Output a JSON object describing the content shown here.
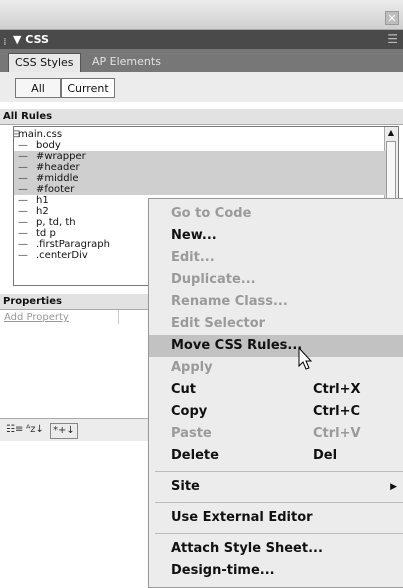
{
  "panel": {
    "title": "▼ CSS",
    "grip": "⁞",
    "menu_icon": "☰",
    "tabs": [
      {
        "label": "CSS Styles"
      },
      {
        "label": "AP Elements"
      }
    ],
    "toggles": [
      {
        "label": "All"
      },
      {
        "label": "Current"
      }
    ],
    "all_rules_heading": "All Rules",
    "rules": [
      {
        "prefix": "⊟ ",
        "label": "main.css",
        "indent": 0,
        "selected": false
      },
      {
        "prefix": "—",
        "label": "body",
        "indent": 1,
        "selected": false
      },
      {
        "prefix": "—",
        "label": "#wrapper",
        "indent": 1,
        "selected": true
      },
      {
        "prefix": "—",
        "label": "#header",
        "indent": 1,
        "selected": true
      },
      {
        "prefix": "—",
        "label": "#middle",
        "indent": 1,
        "selected": true
      },
      {
        "prefix": "—",
        "label": "#footer",
        "indent": 1,
        "selected": true
      },
      {
        "prefix": "—",
        "label": "h1",
        "indent": 1,
        "selected": false
      },
      {
        "prefix": "—",
        "label": "h2",
        "indent": 1,
        "selected": false
      },
      {
        "prefix": "—",
        "label": "p, td, th",
        "indent": 1,
        "selected": false
      },
      {
        "prefix": "—",
        "label": "td p",
        "indent": 1,
        "selected": false
      },
      {
        "prefix": "—",
        "label": ".firstParagraph",
        "indent": 1,
        "selected": false
      },
      {
        "prefix": "—",
        "label": ".centerDiv",
        "indent": 1,
        "selected": false
      }
    ],
    "properties_heading": "Properties",
    "add_property": "Add Property",
    "bottom_icons": [
      "☷≡",
      "ᴬz↓",
      "*+↓"
    ]
  },
  "context_menu": {
    "items": [
      {
        "label": "Go to Code",
        "shortcut": "",
        "disabled": true
      },
      {
        "label": "New...",
        "shortcut": "",
        "disabled": false
      },
      {
        "label": "Edit...",
        "shortcut": "",
        "disabled": true
      },
      {
        "label": "Duplicate...",
        "shortcut": "",
        "disabled": true
      },
      {
        "label": "Rename Class...",
        "shortcut": "",
        "disabled": true
      },
      {
        "label": "Edit Selector",
        "shortcut": "",
        "disabled": true
      },
      {
        "label": "Move CSS Rules...",
        "shortcut": "",
        "disabled": false,
        "highlighted": true
      },
      {
        "label": "Apply",
        "shortcut": "",
        "disabled": true
      },
      {
        "label": "Cut",
        "shortcut": "Ctrl+X",
        "disabled": false
      },
      {
        "label": "Copy",
        "shortcut": "Ctrl+C",
        "disabled": false
      },
      {
        "label": "Paste",
        "shortcut": "Ctrl+V",
        "disabled": true
      },
      {
        "label": "Delete",
        "shortcut": "Del",
        "disabled": false
      },
      {
        "separator": true
      },
      {
        "label": "Site",
        "shortcut": "",
        "disabled": false,
        "submenu": true
      },
      {
        "separator": true
      },
      {
        "label": "Use External Editor",
        "shortcut": "",
        "disabled": false
      },
      {
        "separator": true
      },
      {
        "label": "Attach Style Sheet...",
        "shortcut": "",
        "disabled": false
      },
      {
        "label": "Design-time...",
        "shortcut": "",
        "disabled": false
      }
    ]
  }
}
